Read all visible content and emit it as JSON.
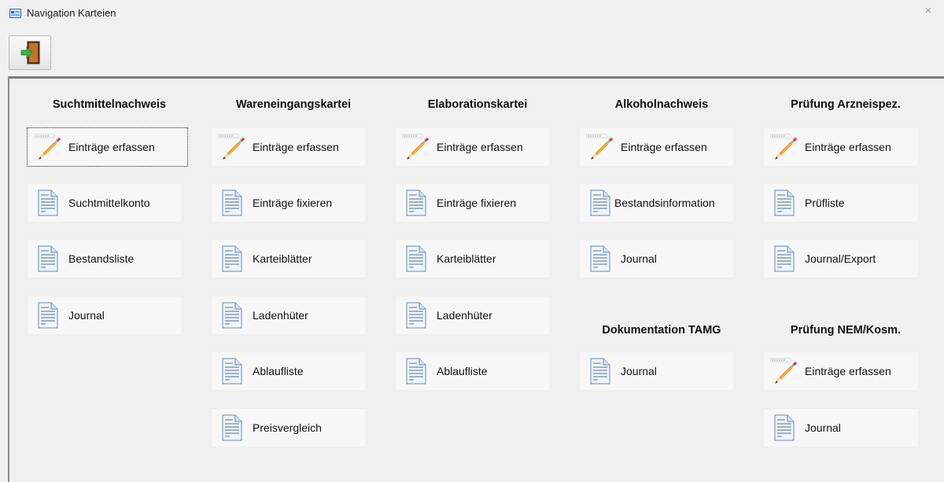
{
  "window": {
    "title": "Navigation Karteien",
    "close_glyph": "✕"
  },
  "toolbar": {
    "exit_icon": "exit-door-icon"
  },
  "columns": [
    {
      "title": "Suchtmittelnachweis",
      "items": [
        {
          "label": "Einträge erfassen",
          "icon": "pencil-icon"
        },
        {
          "label": "Suchtmittelkonto",
          "icon": "document-icon"
        },
        {
          "label": "Bestandsliste",
          "icon": "document-icon"
        },
        {
          "label": "Journal",
          "icon": "document-icon"
        }
      ]
    },
    {
      "title": "Wareneingangskartei",
      "items": [
        {
          "label": "Einträge erfassen",
          "icon": "pencil-icon"
        },
        {
          "label": "Einträge fixieren",
          "icon": "document-icon"
        },
        {
          "label": "Karteiblätter",
          "icon": "document-icon"
        },
        {
          "label": "Ladenhüter",
          "icon": "document-icon"
        },
        {
          "label": "Ablaufliste",
          "icon": "document-icon"
        },
        {
          "label": "Preisvergleich",
          "icon": "document-icon"
        }
      ]
    },
    {
      "title": "Elaborationskartei",
      "items": [
        {
          "label": "Einträge erfassen",
          "icon": "pencil-icon"
        },
        {
          "label": "Einträge fixieren",
          "icon": "document-icon"
        },
        {
          "label": "Karteiblätter",
          "icon": "document-icon"
        },
        {
          "label": "Ladenhüter",
          "icon": "document-icon"
        },
        {
          "label": "Ablaufliste",
          "icon": "document-icon"
        }
      ]
    },
    {
      "title": "Alkoholnachweis",
      "items": [
        {
          "label": "Einträge erfassen",
          "icon": "pencil-icon"
        },
        {
          "label": "Bestandsinformation",
          "icon": "document-icon"
        },
        {
          "label": "Journal",
          "icon": "document-icon"
        }
      ],
      "title2": "Dokumentation TAMG",
      "items2": [
        {
          "label": "Journal",
          "icon": "document-icon"
        }
      ]
    },
    {
      "title": "Prüfung Arzneispez.",
      "items": [
        {
          "label": "Einträge erfassen",
          "icon": "pencil-icon"
        },
        {
          "label": "Prüfliste",
          "icon": "document-icon"
        },
        {
          "label": "Journal/Export",
          "icon": "document-icon"
        }
      ],
      "title2": "Prüfung NEM/Kosm.",
      "items2": [
        {
          "label": "Einträge erfassen",
          "icon": "pencil-icon"
        },
        {
          "label": "Journal",
          "icon": "document-icon"
        }
      ]
    }
  ]
}
